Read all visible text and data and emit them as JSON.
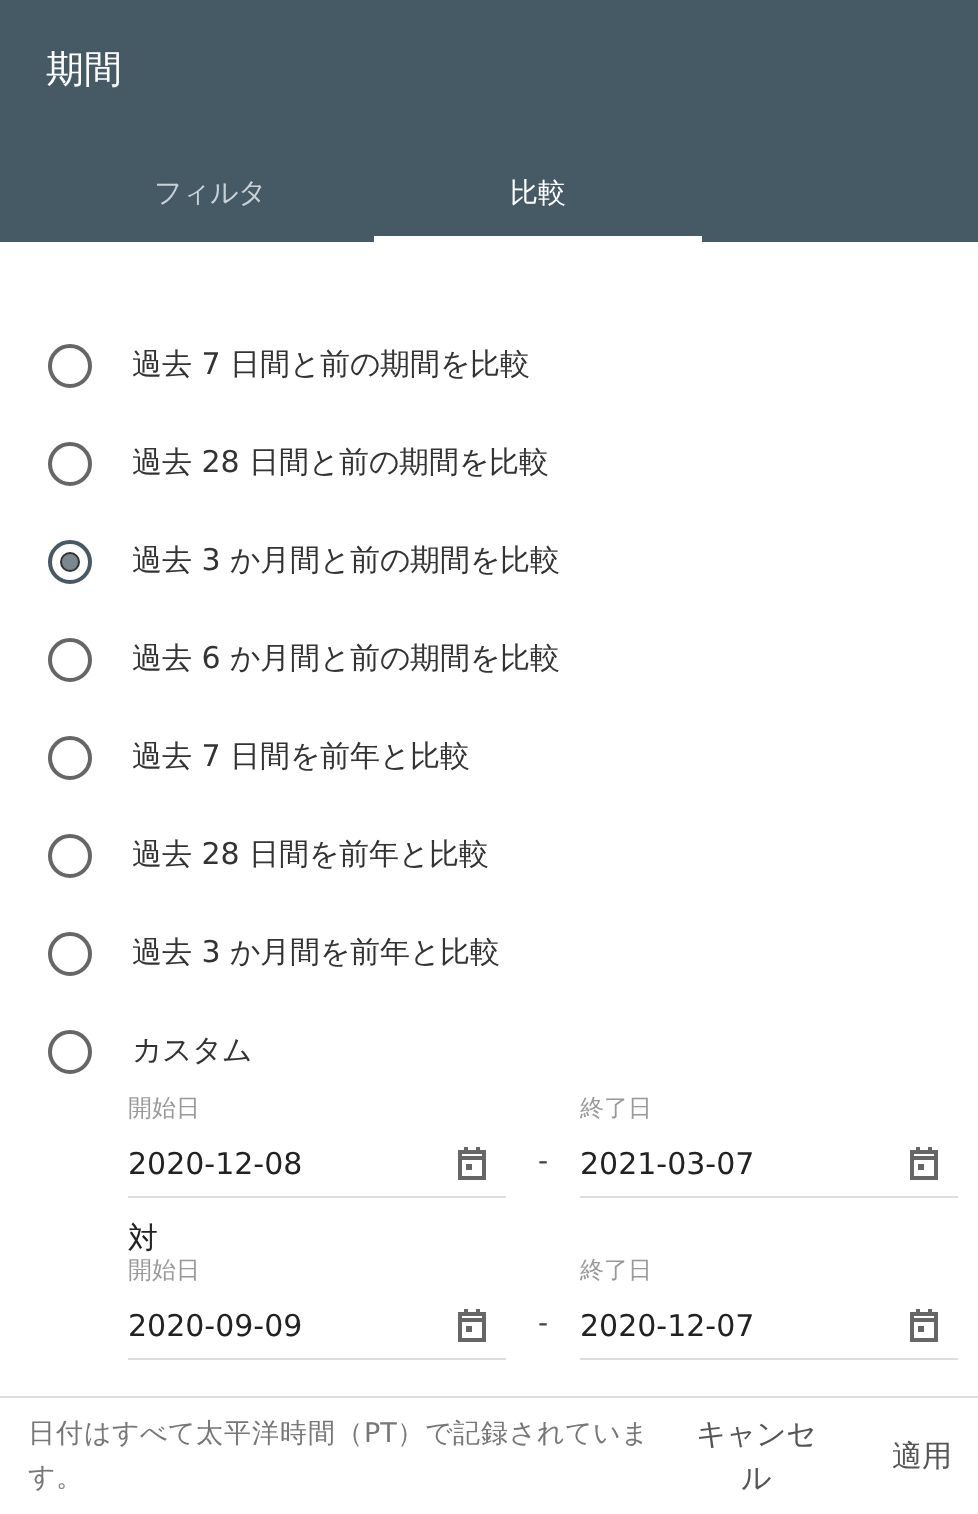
{
  "title": "期間",
  "tabs": [
    {
      "label": "フィルタ",
      "selected": false
    },
    {
      "label": "比較",
      "selected": true
    }
  ],
  "options": [
    {
      "label": "過去 7 日間と前の期間を比較",
      "selected": false
    },
    {
      "label": "過去 28 日間と前の期間を比較",
      "selected": false
    },
    {
      "label": "過去 3 か月間と前の期間を比較",
      "selected": true
    },
    {
      "label": "過去 6 か月間と前の期間を比較",
      "selected": false
    },
    {
      "label": "過去 7 日間を前年と比較",
      "selected": false
    },
    {
      "label": "過去 28 日間を前年と比較",
      "selected": false
    },
    {
      "label": "過去 3 か月間を前年と比較",
      "selected": false
    },
    {
      "label": "カスタム",
      "selected": false
    }
  ],
  "custom": {
    "ranges": [
      {
        "start_label": "開始日",
        "start": "2020-12-08",
        "separator": "-",
        "end_label": "終了日",
        "end": "2021-03-07"
      },
      {
        "heading": "対",
        "start_label": "開始日",
        "start": "2020-09-09",
        "separator": "-",
        "end_label": "終了日",
        "end": "2020-12-07"
      }
    ]
  },
  "footer": {
    "note": "日付はすべて太平洋時間（PT）で記録されています。",
    "buttons": [
      "キャンセル",
      "適用"
    ]
  }
}
